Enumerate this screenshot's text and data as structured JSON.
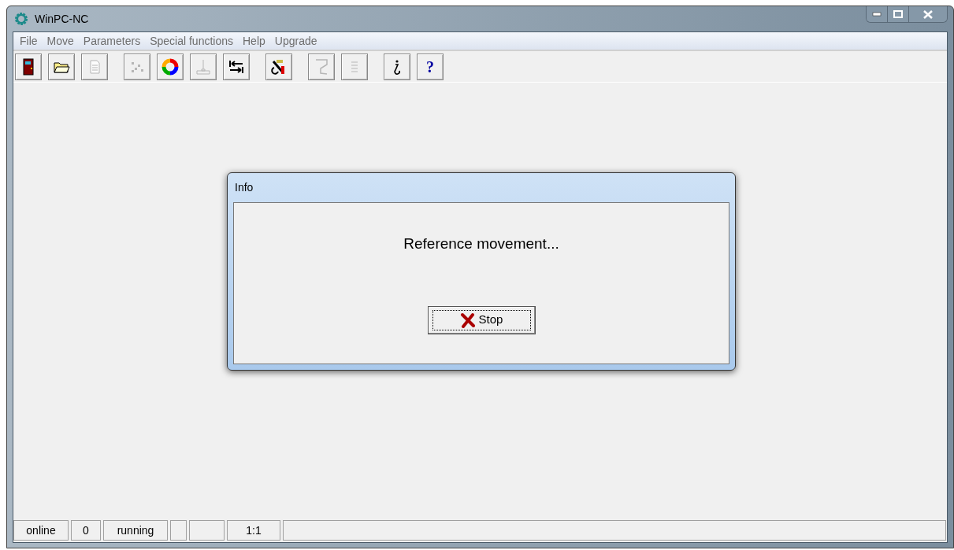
{
  "window": {
    "title": "WinPC-NC"
  },
  "menu": [
    "File",
    "Move",
    "Parameters",
    "Special functions",
    "Help",
    "Upgrade"
  ],
  "toolbar_groups": [
    [
      {
        "kind": "door",
        "disabled": false
      },
      {
        "kind": "folder",
        "disabled": false
      },
      {
        "kind": "document",
        "disabled": true
      }
    ],
    [
      {
        "kind": "dots",
        "disabled": true
      },
      {
        "kind": "cycle",
        "disabled": false
      },
      {
        "kind": "probe",
        "disabled": true
      },
      {
        "kind": "tab-arrows",
        "disabled": false
      }
    ],
    [
      {
        "kind": "wrench",
        "disabled": false
      }
    ],
    [
      {
        "kind": "drill",
        "disabled": true
      },
      {
        "kind": "lines",
        "disabled": true
      }
    ],
    [
      {
        "kind": "info",
        "disabled": false
      },
      {
        "kind": "text",
        "label": "?",
        "disabled": false
      }
    ]
  ],
  "dialog": {
    "title": "Info",
    "message": "Reference movement...",
    "button": "Stop"
  },
  "status_bar": [
    {
      "kind": "text",
      "text": "online"
    },
    {
      "kind": "text",
      "text": "0"
    },
    {
      "kind": "text",
      "text": "running"
    },
    {
      "kind": "blank"
    },
    {
      "kind": "blank"
    },
    {
      "kind": "text",
      "text": "1:1"
    },
    {
      "kind": "blank"
    }
  ]
}
